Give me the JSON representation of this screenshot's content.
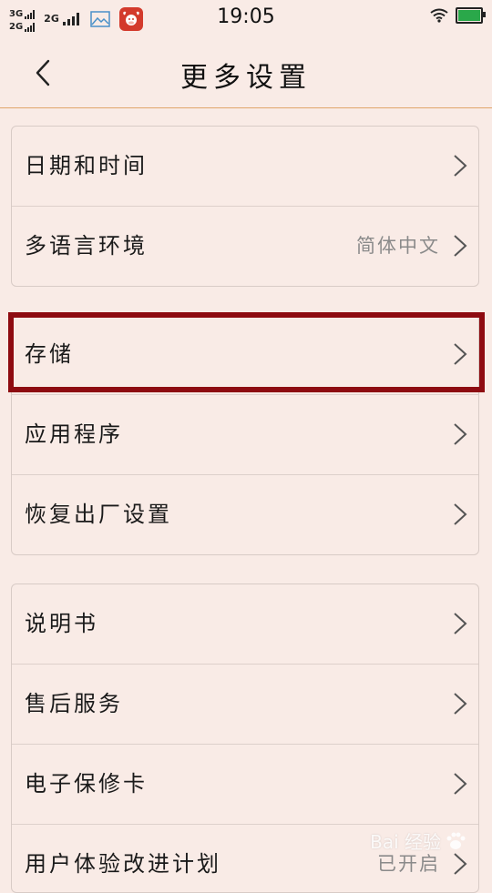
{
  "status_bar": {
    "sim1": {
      "network": "3G"
    },
    "sim2": {
      "network": "2G"
    },
    "sim3": {
      "network": "2G"
    },
    "time": "19:05",
    "battery_level": 1.0
  },
  "header": {
    "title": "更多设置"
  },
  "groups": [
    {
      "items": [
        {
          "label": "日期和时间",
          "value": ""
        },
        {
          "label": "多语言环境",
          "value": "简体中文"
        }
      ]
    },
    {
      "items": [
        {
          "label": "存储",
          "value": ""
        },
        {
          "label": "应用程序",
          "value": ""
        },
        {
          "label": "恢复出厂设置",
          "value": ""
        }
      ]
    },
    {
      "items": [
        {
          "label": "说明书",
          "value": ""
        },
        {
          "label": "售后服务",
          "value": ""
        },
        {
          "label": "电子保修卡",
          "value": ""
        },
        {
          "label": "用户体验改进计划",
          "value": "已开启"
        }
      ]
    }
  ],
  "watermark": {
    "text": "Bai 经验"
  },
  "colors": {
    "accent_line": "#e0a56a",
    "highlight": "#8e0b11",
    "background": "#f9ebe6"
  }
}
